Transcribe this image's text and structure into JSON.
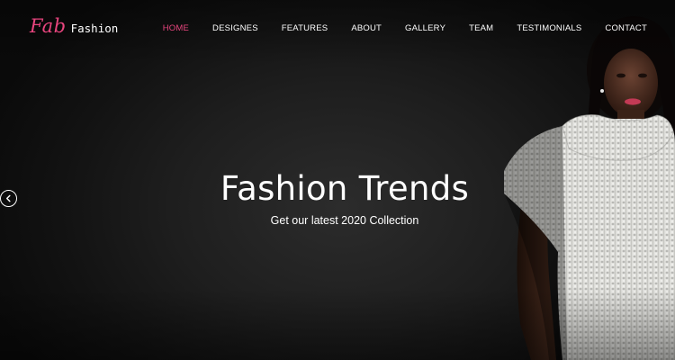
{
  "logo": {
    "script": "Fab",
    "word": "Fashion"
  },
  "nav": {
    "items": [
      {
        "label": "HOME",
        "active": true
      },
      {
        "label": "DESIGNES",
        "active": false
      },
      {
        "label": "FEATURES",
        "active": false
      },
      {
        "label": "ABOUT",
        "active": false
      },
      {
        "label": "GALLERY",
        "active": false
      },
      {
        "label": "TEAM",
        "active": false
      },
      {
        "label": "TESTIMONIALS",
        "active": false
      },
      {
        "label": "CONTACT",
        "active": false
      }
    ]
  },
  "hero": {
    "title": "Fashion Trends",
    "subtitle": "Get our latest 2020 Collection"
  },
  "slider": {
    "prev_icon": "chevron-left-icon"
  },
  "colors": {
    "accent": "#e8457e",
    "background": "#1e1e1e",
    "text": "#ffffff"
  }
}
